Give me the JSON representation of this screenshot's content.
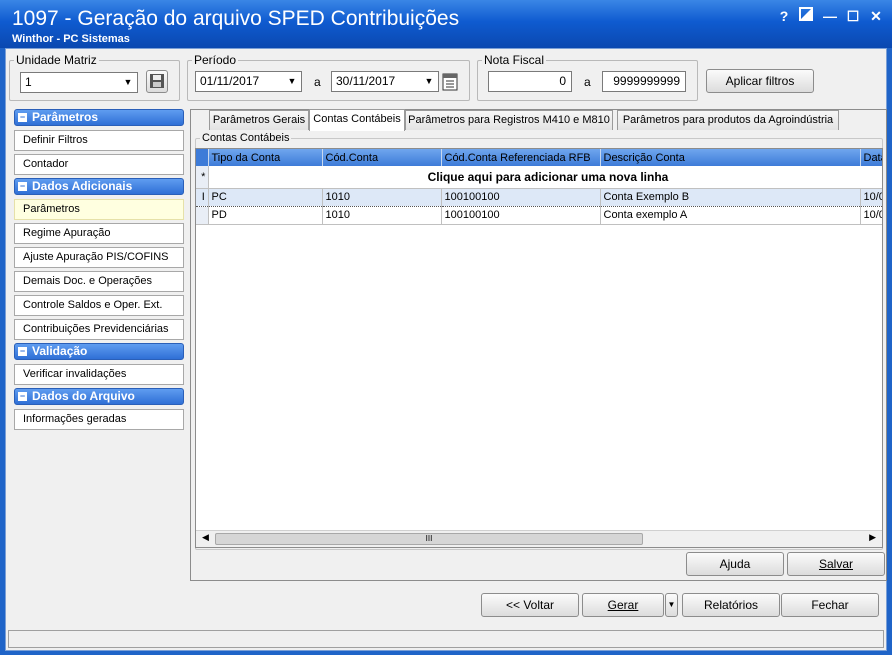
{
  "window": {
    "title": "1097 - Geração do arquivo SPED Contribuições",
    "subtitle": "Winthor - PC Sistemas",
    "controls": {
      "help": "?",
      "minimize": "—",
      "maximize": "☐",
      "close": "✕"
    }
  },
  "filters": {
    "unidade_legend": "Unidade Matriz",
    "unidade_value": "1",
    "periodo_legend": "Período",
    "date_from": "01/11/2017",
    "a1": "a",
    "date_to": "30/11/2017",
    "nota_legend": "Nota Fiscal",
    "nota_from": "0",
    "a2": "a",
    "nota_to": "9999999999",
    "apply_label": "Aplicar filtros"
  },
  "sidebar": {
    "sections": [
      {
        "title": "Parâmetros",
        "items": [
          "Definir Filtros",
          "Contador"
        ]
      },
      {
        "title": "Dados Adicionais",
        "items": [
          "Parâmetros",
          "Regime Apuração",
          "Ajuste Apuração PIS/COFINS",
          "Demais Doc. e Operações",
          "Controle Saldos e Oper. Ext.",
          "Contribuições Previdenciárias"
        ]
      },
      {
        "title": "Validação",
        "items": [
          "Verificar invalidações"
        ]
      },
      {
        "title": "Dados do Arquivo",
        "items": [
          "Informações geradas"
        ]
      }
    ]
  },
  "tabs": [
    "Parâmetros Gerais",
    "Contas Contábeis",
    "Parâmetros para Registros M410 e M810",
    "Parâmetros para produtos da Agroindústria"
  ],
  "group_label": "Contas Contábeis",
  "grid": {
    "columns": [
      "Tipo da Conta",
      "Cód.Conta",
      "Cód.Conta Referenciada RFB",
      "Descrição Conta",
      "Data"
    ],
    "new_row_text": "Clique aqui para adicionar uma nova linha",
    "rows": [
      [
        "PC",
        "1010",
        "100100100",
        "Conta Exemplo B",
        "10/0"
      ],
      [
        "PD",
        "1010",
        "100100100",
        "Conta exemplo A",
        "10/0"
      ]
    ],
    "new_row_marker": "*",
    "edit_marker": "I",
    "scroll_grip": "III"
  },
  "panel_buttons": {
    "help": "Ajuda",
    "save": "Salvar"
  },
  "footer_buttons": {
    "back": "<< Voltar",
    "generate": "Gerar",
    "reports": "Relatórios",
    "close": "Fechar"
  },
  "colors": {
    "title_bar": "#0f5bd0",
    "section_header": "#2f6fd6",
    "active_item": "#ffffe0"
  }
}
